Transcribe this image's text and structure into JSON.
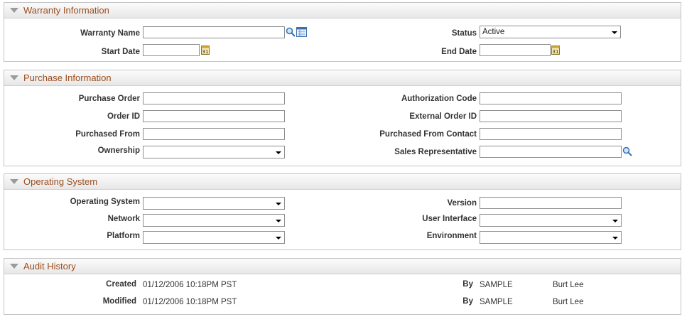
{
  "warranty": {
    "title": "Warranty Information",
    "warranty_name_label": "Warranty Name",
    "warranty_name_value": "",
    "status_label": "Status",
    "status_value": "Active",
    "start_date_label": "Start Date",
    "start_date_value": "",
    "end_date_label": "End Date",
    "end_date_value": ""
  },
  "purchase": {
    "title": "Purchase Information",
    "purchase_order_label": "Purchase Order",
    "order_id_label": "Order ID",
    "purchased_from_label": "Purchased From",
    "ownership_label": "Ownership",
    "authorization_code_label": "Authorization Code",
    "external_order_id_label": "External Order ID",
    "purchased_from_contact_label": "Purchased From Contact",
    "sales_rep_label": "Sales Representative"
  },
  "os": {
    "title": "Operating System",
    "operating_system_label": "Operating System",
    "network_label": "Network",
    "platform_label": "Platform",
    "version_label": "Version",
    "user_interface_label": "User Interface",
    "environment_label": "Environment"
  },
  "audit": {
    "title": "Audit History",
    "created_label": "Created",
    "created_value": "01/12/2006 10:18PM PST",
    "created_by_label": "By",
    "created_by_id": "SAMPLE",
    "created_by_name": "Burt Lee",
    "modified_label": "Modified",
    "modified_value": "01/12/2006 10:18PM PST",
    "modified_by_label": "By",
    "modified_by_id": "SAMPLE",
    "modified_by_name": "Burt Lee"
  },
  "icons": {
    "lookup": "magnifier-icon",
    "detail": "detail-grid-icon",
    "calendar": "calendar-icon"
  },
  "colors": {
    "section_title": "#9c4d1d",
    "border": "#c5c5c5"
  }
}
